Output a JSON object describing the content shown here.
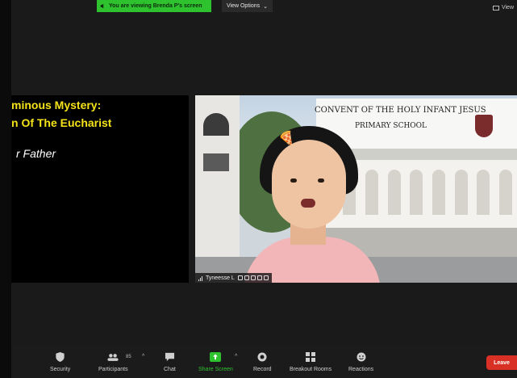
{
  "banner": {
    "text": "You are viewing Brenda P's screen"
  },
  "view_options": {
    "label": "View Options",
    "caret": "⌄"
  },
  "top_right": {
    "label": "View"
  },
  "slide": {
    "line1": "minous Mystery:",
    "line2": "n Of The Eucharist",
    "line3": "r Father"
  },
  "video": {
    "sign_line1": "CONVENT OF THE HOLY INFANT JESUS",
    "sign_line2": "PRIMARY SCHOOL",
    "participant_name": "Tyneesse L"
  },
  "toolbar": {
    "security": "Security",
    "participants": "Participants",
    "participant_count": "85",
    "chat": "Chat",
    "share_screen": "Share Screen",
    "record": "Record",
    "breakout_rooms": "Breakout Rooms",
    "reactions": "Reactions",
    "leave": "Leave",
    "caret": "^"
  },
  "colors": {
    "banner": "#2fc22f",
    "slide_text": "#f5e31a",
    "share_green": "#2fc22f",
    "leave_red": "#d93025"
  }
}
